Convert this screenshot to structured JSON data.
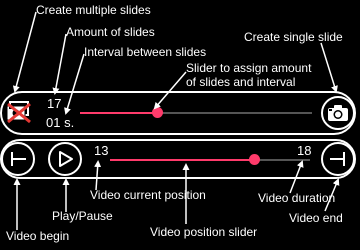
{
  "callouts": {
    "create_multiple": "Create multiple slides",
    "amount": "Amount of slides",
    "interval": "Interval between slides",
    "slider_assign_line1": "Slider to assign amount",
    "slider_assign_line2": "of slides and interval",
    "create_single": "Create single slide",
    "video_current": "Video current position",
    "play_pause": "Play/Pause",
    "video_duration": "Video duration",
    "video_end": "Video end",
    "video_begin": "Video begin",
    "video_slider": "Video position slider"
  },
  "slides_panel": {
    "amount_value": "17",
    "interval_value": "01 s.",
    "slider_value": 0.33
  },
  "video_panel": {
    "current_value": "13",
    "duration_value": "18",
    "slider_value": 0.72
  },
  "colors": {
    "accent": "#ff3b6b",
    "track_inactive": "#555555",
    "background": "#000000",
    "foreground": "#ffffff"
  },
  "icons": {
    "multi": "multi-photo-icon",
    "camera": "camera-icon",
    "begin": "skip-begin-icon",
    "play": "play-icon",
    "end": "skip-end-icon"
  }
}
